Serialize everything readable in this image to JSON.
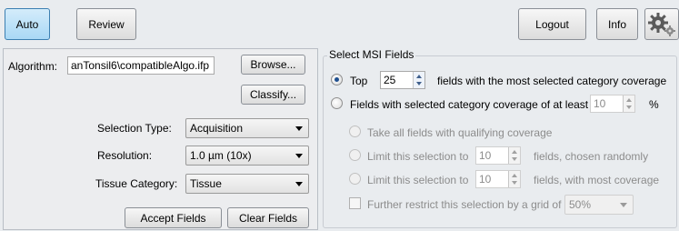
{
  "toolbar": {
    "auto_label": "Auto",
    "review_label": "Review",
    "logout_label": "Logout",
    "info_label": "Info",
    "settings_icon": "gear-icon"
  },
  "left": {
    "algorithm_label": "Algorithm:",
    "algorithm_value": "anTonsil6\\compatibleAlgo.ifp",
    "browse_label": "Browse...",
    "classify_label": "Classify...",
    "selection_type_label": "Selection Type:",
    "selection_type_value": "Acquisition",
    "resolution_label": "Resolution:",
    "resolution_value": "1.0 µm (10x)",
    "tissue_category_label": "Tissue Category:",
    "tissue_category_value": "Tissue",
    "accept_label": "Accept Fields",
    "clear_label": "Clear Fields"
  },
  "right": {
    "group_title": "Select MSI Fields",
    "top_label": "Top",
    "top_value": "25",
    "top_suffix": "fields with the most selected category coverage",
    "coverage_label": "Fields with selected category coverage of at least",
    "coverage_value": "10",
    "coverage_unit": "%",
    "take_all_label": "Take all fields with qualifying coverage",
    "limit_random_label": "Limit this selection to",
    "limit_random_value": "10",
    "limit_random_suffix": "fields, chosen randomly",
    "limit_coverage_label": "Limit this selection to",
    "limit_coverage_value": "10",
    "limit_coverage_suffix": "fields, with most coverage",
    "grid_label": "Further restrict this selection by a grid of",
    "grid_value": "50%"
  }
}
